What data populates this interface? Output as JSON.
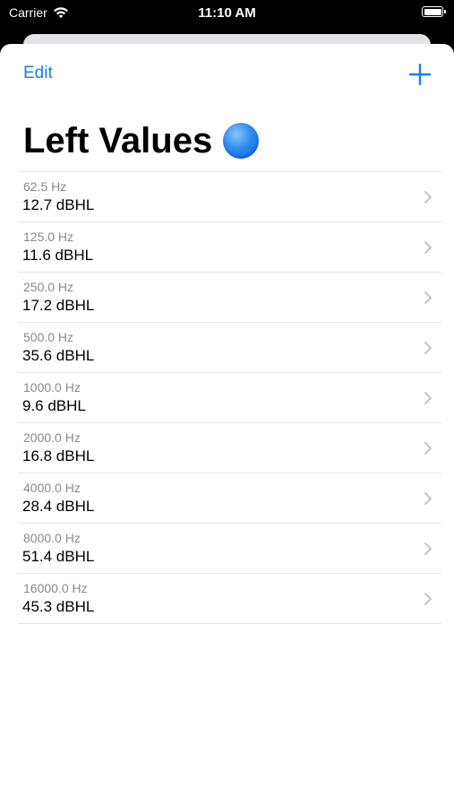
{
  "status_bar": {
    "carrier": "Carrier",
    "time": "11:10 AM"
  },
  "nav": {
    "edit_label": "Edit",
    "add_icon": "plus-icon"
  },
  "title": {
    "text": "Left Values",
    "emoji_icon": "blue-circle-icon",
    "emoji_color": "#2f8af2"
  },
  "colors": {
    "accent": "#1a7cf5",
    "secondary_text": "#8a8a8e",
    "separator": "#e6e6e9"
  },
  "rows": [
    {
      "frequency": "62.5 Hz",
      "value": "12.7 dBHL"
    },
    {
      "frequency": "125.0 Hz",
      "value": "11.6 dBHL"
    },
    {
      "frequency": "250.0 Hz",
      "value": "17.2 dBHL"
    },
    {
      "frequency": "500.0 Hz",
      "value": "35.6 dBHL"
    },
    {
      "frequency": "1000.0 Hz",
      "value": "9.6 dBHL"
    },
    {
      "frequency": "2000.0 Hz",
      "value": "16.8 dBHL"
    },
    {
      "frequency": "4000.0 Hz",
      "value": "28.4 dBHL"
    },
    {
      "frequency": "8000.0 Hz",
      "value": "51.4 dBHL"
    },
    {
      "frequency": "16000.0 Hz",
      "value": "45.3 dBHL"
    }
  ]
}
